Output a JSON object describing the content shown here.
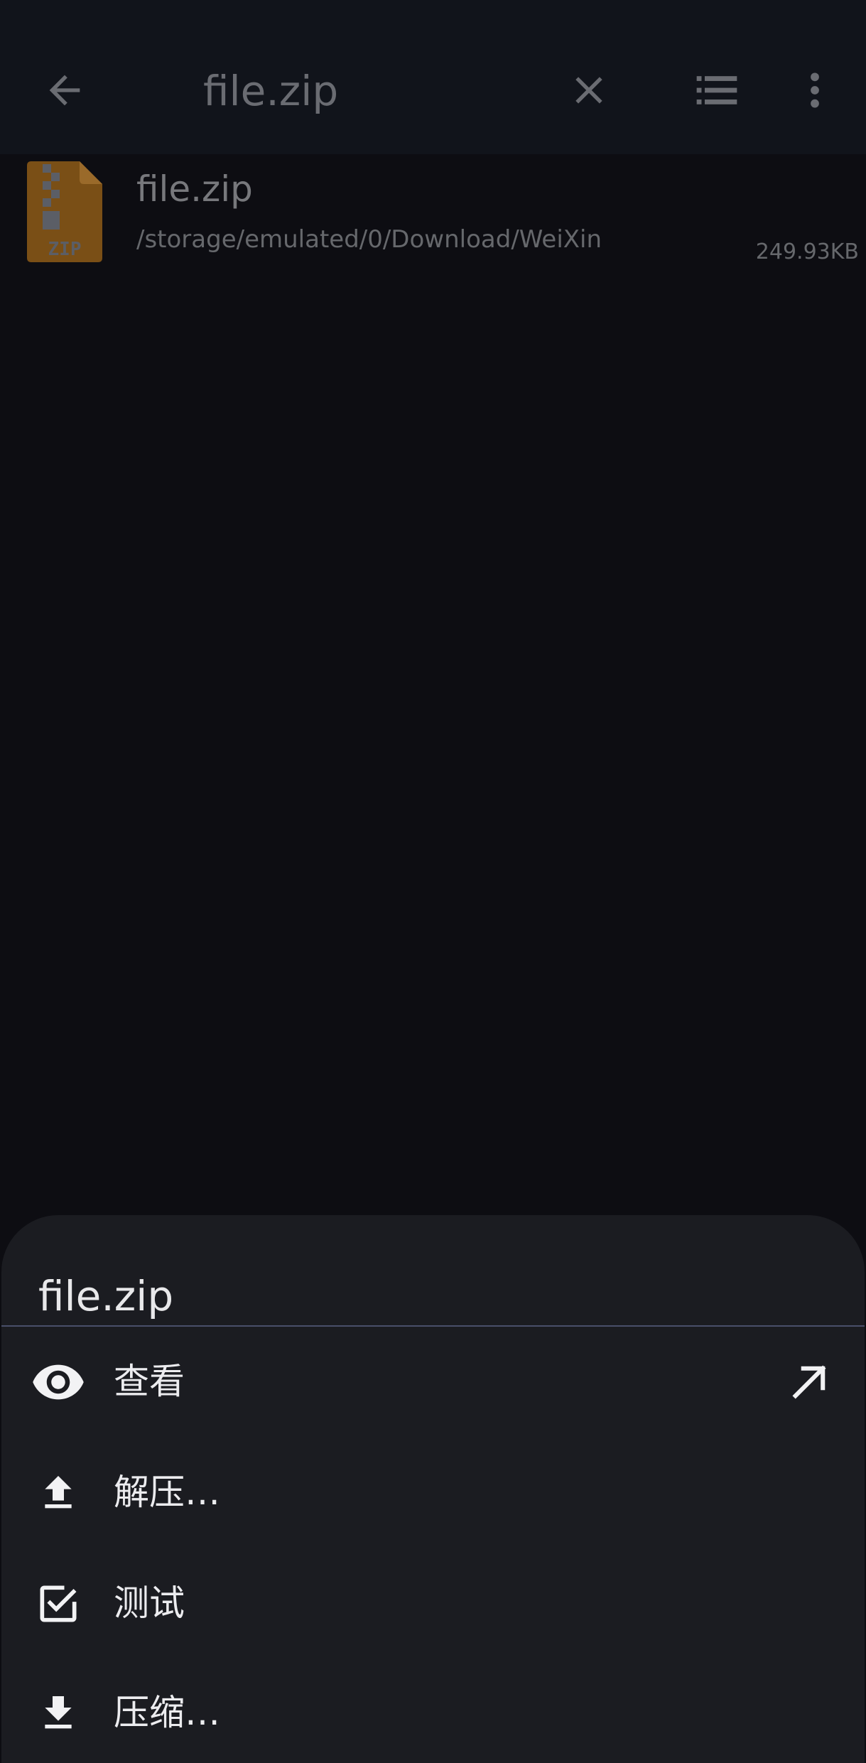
{
  "appbar": {
    "title": "file.zip",
    "icons": [
      "back-arrow-icon",
      "close-icon",
      "list-view-icon",
      "more-vert-icon"
    ]
  },
  "file": {
    "name": "file.zip",
    "path": "/storage/emulated/0/Download/WeiXin",
    "size": "249.93KB",
    "icon_label": "ZIP"
  },
  "sheet": {
    "title": "file.zip",
    "items": [
      {
        "label": "查看",
        "icon": "eye-icon",
        "trailing_icon": "open-external-arrow-icon"
      },
      {
        "label": "解压…",
        "icon": "upload-icon"
      },
      {
        "label": "测试",
        "icon": "checkbox-icon"
      },
      {
        "label": "压缩…",
        "icon": "download-icon"
      }
    ]
  },
  "colors": {
    "background": "#0d0d12",
    "appbar": "#11141b",
    "sheet": "#1b1c21",
    "zip_orange": "#8a5a1a"
  }
}
